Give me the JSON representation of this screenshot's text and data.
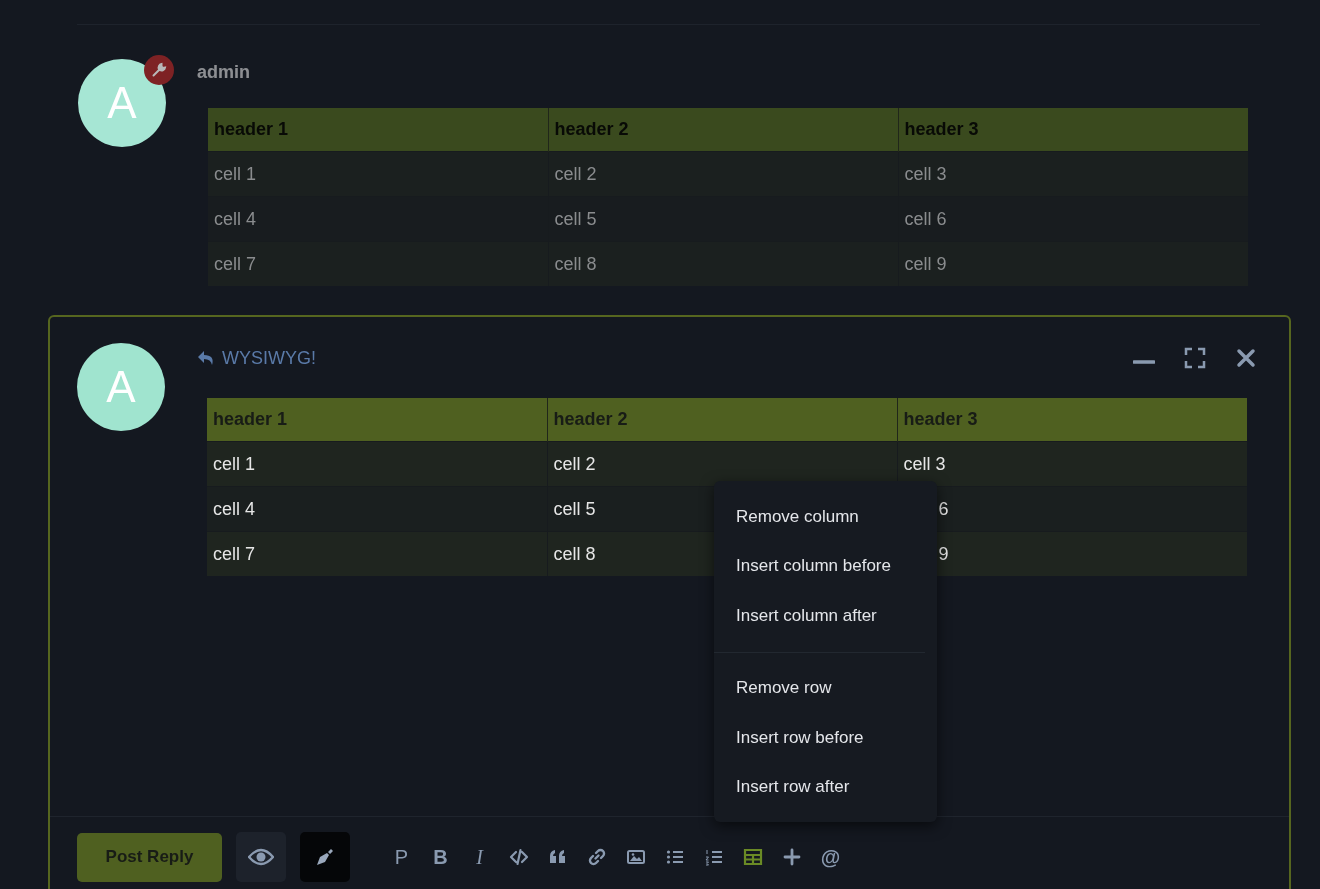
{
  "previous_post": {
    "author": "admin",
    "avatar_letter": "A",
    "table": {
      "columns": [
        "header 1",
        "header 2",
        "header 3"
      ],
      "rows": [
        [
          {
            "text": "cell 1",
            "covered": false
          },
          {
            "text": "cell 2",
            "covered": false
          },
          {
            "text": "cell 3",
            "covered": false
          }
        ],
        [
          {
            "text": "cell 4",
            "covered": false
          },
          {
            "text": "cell 5",
            "covered": false
          },
          {
            "text": "cell 6",
            "covered": false
          }
        ],
        [
          {
            "text": "cell 7",
            "covered": false
          },
          {
            "text": "cell 8",
            "covered": false
          },
          {
            "text": "cell 9",
            "covered": false
          }
        ]
      ]
    }
  },
  "editor": {
    "avatar_letter": "A",
    "reply_title": "WYSIWYG!",
    "table": {
      "columns": [
        "header 1",
        "header 2",
        "header 3"
      ],
      "rows": [
        [
          {
            "text": "cell 1",
            "covered": false
          },
          {
            "text": "cell 2",
            "covered": false
          },
          {
            "text": "cell 3",
            "covered": false
          }
        ],
        [
          {
            "text": "cell 4",
            "covered": false
          },
          {
            "text": "cell 5",
            "covered": false
          },
          {
            "text": "6",
            "covered": true
          }
        ],
        [
          {
            "text": "cell 7",
            "covered": false
          },
          {
            "text": "cell 8",
            "covered": false
          },
          {
            "text": "9",
            "covered": true
          }
        ]
      ]
    }
  },
  "context_menu": {
    "groups": [
      [
        "Remove column",
        "Insert column before",
        "Insert column after"
      ],
      [
        "Remove row",
        "Insert row before",
        "Insert row after"
      ]
    ]
  },
  "footer": {
    "submit": "Post Reply",
    "modes": [
      {
        "selected": false
      },
      {
        "selected": true
      }
    ],
    "toolbar": [
      {
        "kind": "glyph",
        "text": "P",
        "selected": false
      },
      {
        "kind": "glyph",
        "text": "B",
        "selected": false
      },
      {
        "kind": "glyph",
        "text": "I",
        "selected": false
      },
      {
        "kind": "icon",
        "selected": false
      },
      {
        "kind": "icon",
        "selected": false
      },
      {
        "kind": "icon",
        "selected": false
      },
      {
        "kind": "icon",
        "selected": false
      },
      {
        "kind": "icon",
        "selected": false
      },
      {
        "kind": "icon",
        "selected": false
      },
      {
        "kind": "icon",
        "selected": true
      },
      {
        "kind": "icon",
        "selected": false
      },
      {
        "kind": "glyph",
        "text": "@",
        "selected": false
      }
    ]
  }
}
